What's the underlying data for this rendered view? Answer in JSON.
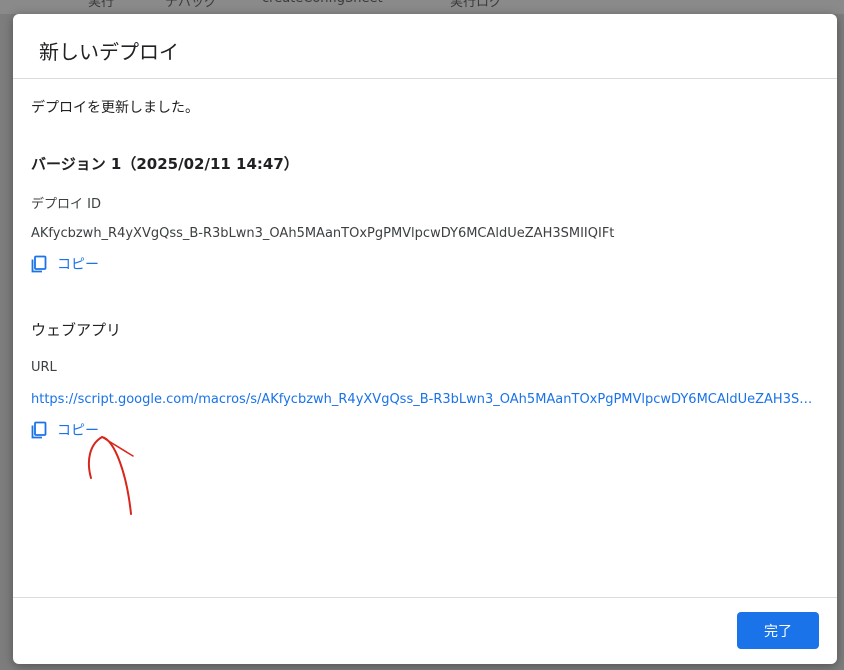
{
  "background": {
    "toolbar_items": [
      "実行",
      "デバッグ",
      "createConfigSheet",
      "実行ログ"
    ]
  },
  "dialog": {
    "title": "新しいデプロイ",
    "message": "デプロイを更新しました。",
    "version_heading": "バージョン 1（2025/02/11 14:47）",
    "deploy_id_label": "デプロイ ID",
    "deploy_id_value": "AKfycbzwh_R4yXVgQss_B-R3bLwn3_OAh5MAanTOxPgPMVlpcwDY6MCAldUeZAH3SMIIQIFt",
    "copy_label": "コピー",
    "webapp_heading": "ウェブアプリ",
    "url_label": "URL",
    "url_value": "https://script.google.com/macros/s/AKfycbzwh_R4yXVgQss_B-R3bLwn3_OAh5MAanTOxPgPMVlpcwDY6MCAldUeZAH3SMIIQIFt/exec",
    "done_label": "完了"
  },
  "colors": {
    "accent": "#1a73e8",
    "annotation": "#d9261c"
  },
  "icons": {
    "copy": "copy-icon"
  }
}
